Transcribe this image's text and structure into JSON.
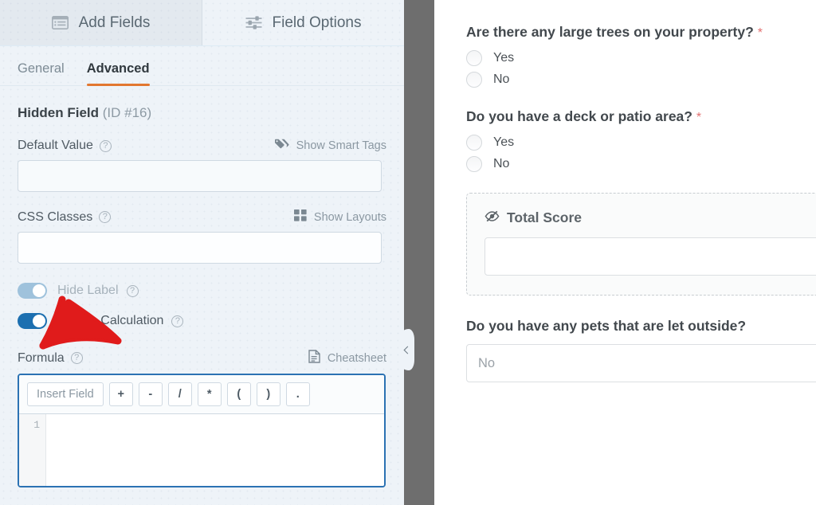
{
  "builder": {
    "tabs": [
      {
        "label": "Add Fields",
        "icon": "list-fields-icon",
        "active": false
      },
      {
        "label": "Field Options",
        "icon": "sliders-icon",
        "active": true
      }
    ],
    "subtabs": [
      {
        "label": "General",
        "active": false
      },
      {
        "label": "Advanced",
        "active": true
      }
    ],
    "field_heading": {
      "name": "Hidden Field",
      "id_tag": "(ID #16)"
    },
    "help_glyph": "?",
    "options": {
      "default_value": {
        "label": "Default Value",
        "link_label": "Show Smart Tags",
        "link_icon": "tag-icon",
        "value": ""
      },
      "css_classes": {
        "label": "CSS Classes",
        "link_label": "Show Layouts",
        "link_icon": "grid-layout-icon",
        "value": ""
      },
      "hide_label": {
        "label": "Hide Label",
        "state": "on-faded"
      },
      "enable_calculation": {
        "label": "Enable Calculation",
        "state": "on"
      },
      "formula": {
        "label": "Formula",
        "link_label": "Cheatsheet",
        "link_icon": "document-icon",
        "toolbar": [
          "Insert Field",
          "+",
          "-",
          "/",
          "*",
          "(",
          ")",
          "."
        ],
        "line_numbers": [
          "1"
        ],
        "code": ""
      }
    },
    "collapse_handle": {
      "icon": "chevron-left-icon"
    }
  },
  "preview": {
    "blocks": [
      {
        "type": "radio",
        "label": "Are there any large trees on your property?",
        "required": "*",
        "choices": [
          "Yes",
          "No"
        ]
      },
      {
        "type": "radio",
        "label": "Do you have a deck or patio area?",
        "required": "*",
        "choices": [
          "Yes",
          "No"
        ]
      },
      {
        "type": "hidden",
        "label": "Total Score",
        "icon": "eye-slash-icon",
        "value": ""
      },
      {
        "type": "select",
        "label": "Do you have any pets that are let outside?",
        "required": "",
        "value": "No"
      }
    ]
  },
  "annotation": {
    "type": "hand-drawn-arrow",
    "color": "#e01b1b",
    "points_to": "enable-calculation-toggle"
  },
  "colors": {
    "panel_bg": "#eef3f8",
    "accent_orange": "#e27730",
    "toggle_on": "#1c6fb0",
    "toggle_faded": "#9fc2dc",
    "divider_gray": "#6e6e6e",
    "focus_blue": "#2b72b3",
    "required_red": "#e27070",
    "annotation_red": "#e01b1b"
  }
}
